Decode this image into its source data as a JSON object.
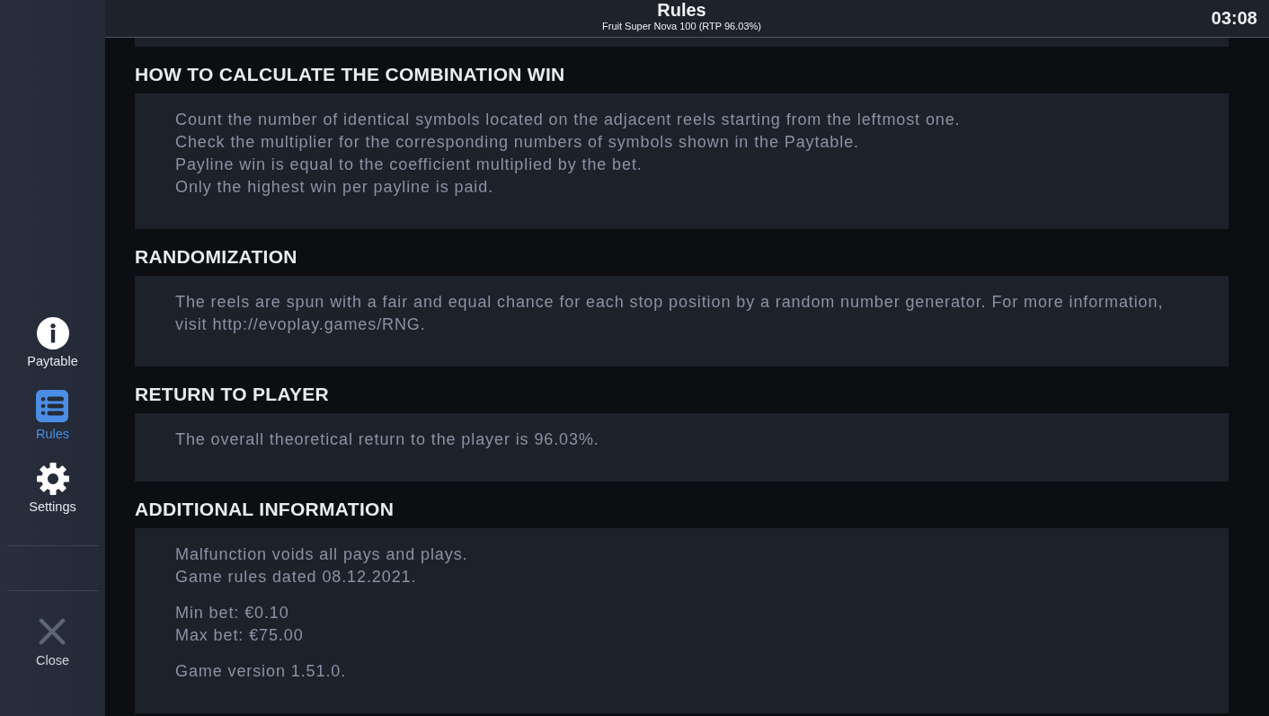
{
  "sidebar": {
    "items": [
      {
        "kind": "info",
        "label": "Paytable",
        "selected": false
      },
      {
        "kind": "rules",
        "label": "Rules",
        "selected": true
      },
      {
        "kind": "settings",
        "label": "Settings",
        "selected": false
      }
    ],
    "close": {
      "label": "Close"
    }
  },
  "header": {
    "title": "Rules",
    "subtitle": "Fruit Super Nova 100 (RTP 96.03%)",
    "time": "03:08"
  },
  "sections": [
    {
      "heading": "HOW TO CALCULATE THE COMBINATION WIN",
      "blocks": [
        [
          "Count the number of identical symbols located on the adjacent reels starting from the leftmost one.",
          "Check the multiplier for the corresponding numbers of symbols shown in the Paytable.",
          "Payline win is equal to the coefficient multiplied by the bet.",
          "Only the highest win per payline is paid."
        ]
      ]
    },
    {
      "heading": "RANDOMIZATION",
      "blocks": [
        [
          "The reels are spun with a fair and equal chance for each stop position by a random number generator. For more information, visit http://evoplay.games/RNG."
        ]
      ]
    },
    {
      "heading": "RETURN TO PLAYER",
      "blocks": [
        [
          "The overall theoretical return to the player is 96.03%."
        ]
      ]
    },
    {
      "heading": "ADDITIONAL INFORMATION",
      "blocks": [
        [
          "Malfunction voids all pays and plays.",
          "Game rules dated 08.12.2021."
        ],
        [
          "Min bet: €0.10",
          "Max bet: €75.00"
        ],
        [
          "Game version 1.51.0."
        ]
      ]
    }
  ]
}
